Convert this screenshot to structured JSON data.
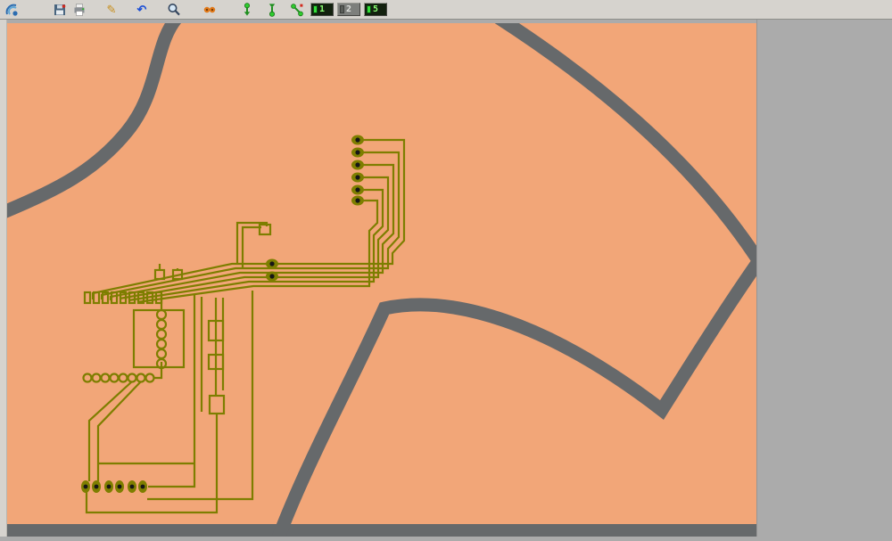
{
  "toolbar": {
    "buttons": [
      {
        "name": "board-icon"
      },
      {
        "name": "save-button"
      },
      {
        "name": "print-button"
      },
      {
        "name": "edit-button",
        "glyph": "✎"
      },
      {
        "name": "undo-button",
        "glyph": "↶"
      },
      {
        "name": "zoom-button"
      },
      {
        "name": "mill-button"
      },
      {
        "name": "plot-down-button"
      },
      {
        "name": "plot-up-button"
      },
      {
        "name": "plot-check-button"
      },
      {
        "name": "layer-1-button",
        "label": "1"
      },
      {
        "name": "layer-2-button",
        "label": "2"
      },
      {
        "name": "layer-5-button",
        "label": "5"
      }
    ]
  },
  "colors": {
    "copper": "#F2A678",
    "groove": "#66696B",
    "trace": "#7E7E00",
    "outside": "#ABABAB",
    "toolbar": "#D6D3CE"
  }
}
